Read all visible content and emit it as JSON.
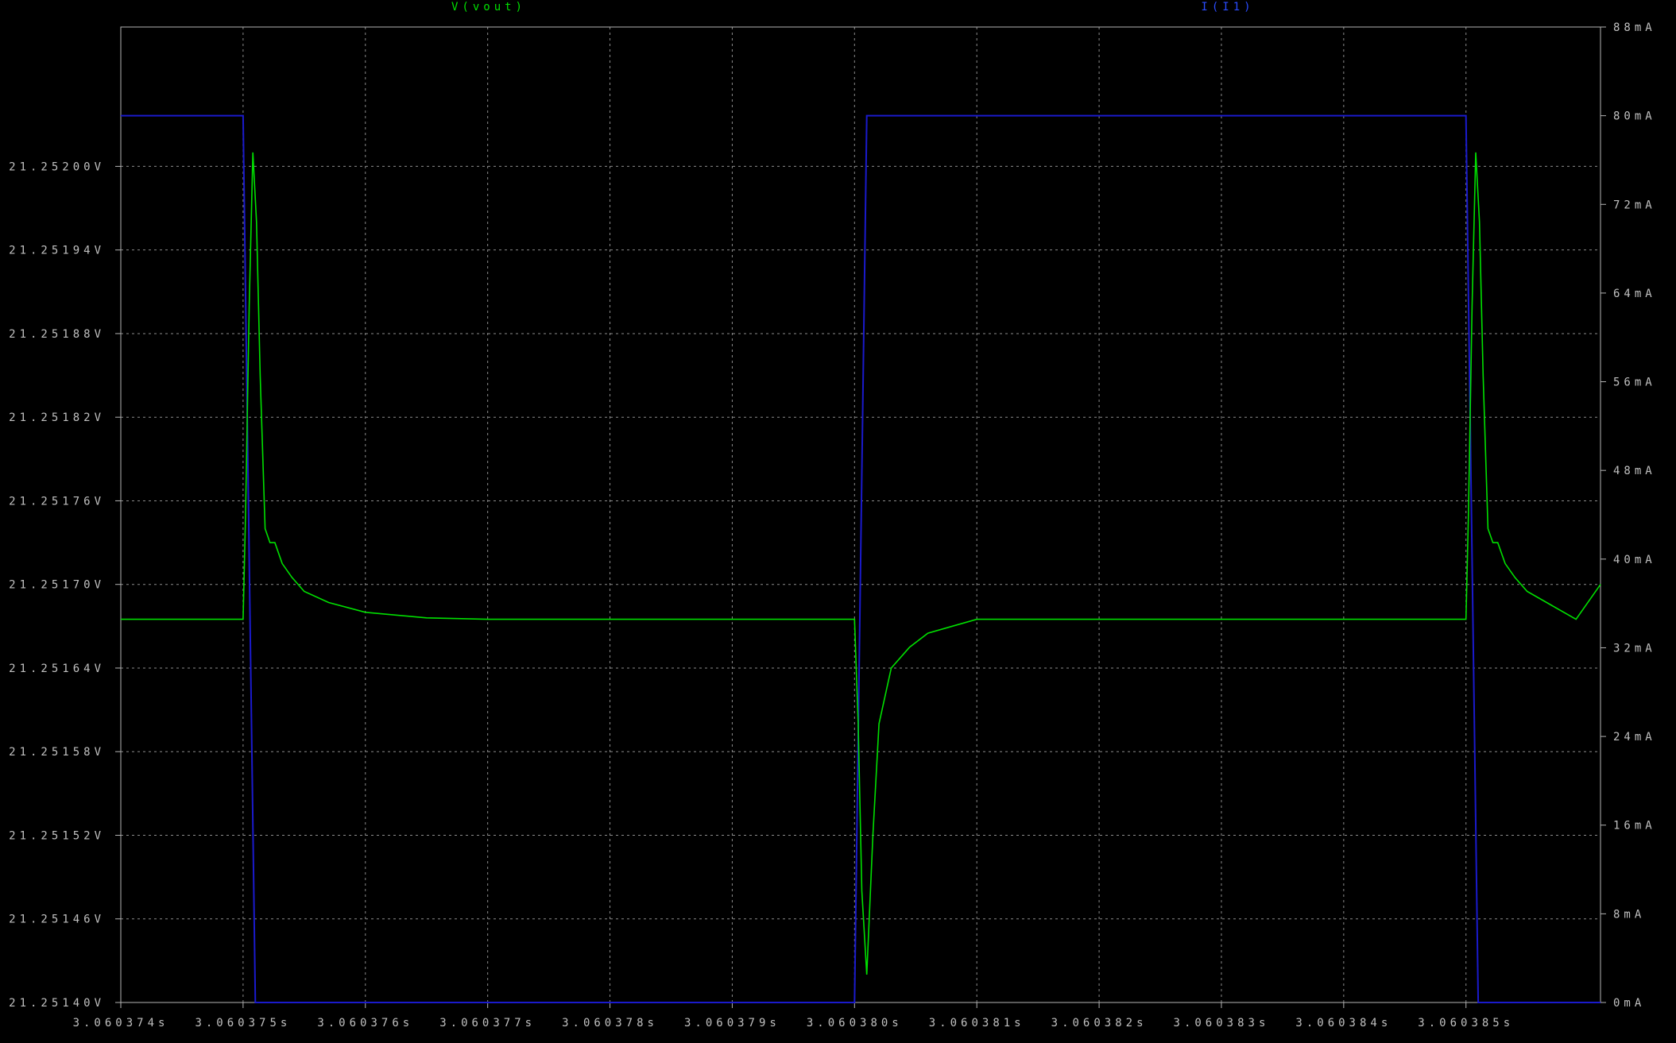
{
  "colors": {
    "background": "#000000",
    "frame": "#b4b4b4",
    "grid": "#8c8c8c",
    "text": "#c0c0c0",
    "vout": "#00e000",
    "current": "#1a1acc",
    "current_label": "#2a4cff"
  },
  "chart_data": {
    "type": "line",
    "grid": true,
    "x": {
      "unit": "s",
      "range": [
        3.060374,
        3.0603861
      ],
      "ticks": [
        3.060374,
        3.060375,
        3.060376,
        3.060377,
        3.060378,
        3.060379,
        3.06038,
        3.060381,
        3.060382,
        3.060383,
        3.060384,
        3.060385
      ],
      "tick_labels": [
        "3.060374s",
        "3.060375s",
        "3.060376s",
        "3.060377s",
        "3.060378s",
        "3.060379s",
        "3.060380s",
        "3.060381s",
        "3.060382s",
        "3.060383s",
        "3.060384s",
        "3.060385s"
      ]
    },
    "y_left": {
      "unit": "V",
      "range": [
        21.2514,
        21.2521
      ],
      "ticks": [
        21.2514,
        21.25146,
        21.25152,
        21.25158,
        21.25164,
        21.2517,
        21.25176,
        21.25182,
        21.25188,
        21.25194,
        21.252
      ],
      "tick_labels": [
        "21.25140V",
        "21.25146V",
        "21.25152V",
        "21.25158V",
        "21.25164V",
        "21.25170V",
        "21.25176V",
        "21.25182V",
        "21.25188V",
        "21.25194V",
        "21.25200V"
      ]
    },
    "y_right": {
      "unit": "mA",
      "range": [
        0,
        88
      ],
      "ticks": [
        0,
        8,
        16,
        24,
        32,
        40,
        48,
        56,
        64,
        72,
        80,
        88
      ],
      "tick_labels": [
        "0mA",
        "8mA",
        "16mA",
        "24mA",
        "32mA",
        "40mA",
        "48mA",
        "56mA",
        "64mA",
        "72mA",
        "80mA",
        "88mA"
      ]
    },
    "series": [
      {
        "name": "V(vout)",
        "axis": "left",
        "x": [
          3.060374,
          3.060375,
          3.06037502,
          3.06037505,
          3.06037508,
          3.06037511,
          3.06037514,
          3.06037518,
          3.06037522,
          3.06037526,
          3.06037532,
          3.0603754,
          3.0603755,
          3.0603757,
          3.060376,
          3.0603765,
          3.060377,
          3.060378,
          3.060379,
          3.06038,
          3.06038003,
          3.06038006,
          3.0603801,
          3.06038015,
          3.0603802,
          3.0603803,
          3.06038045,
          3.0603806,
          3.0603808,
          3.060381,
          3.0603812,
          3.0603815,
          3.060382,
          3.060383,
          3.060384,
          3.060385,
          3.06038502,
          3.06038505,
          3.06038508,
          3.06038511,
          3.06038514,
          3.06038518,
          3.06038522,
          3.06038526,
          3.06038532,
          3.0603854,
          3.0603855,
          3.0603857,
          3.0603859,
          3.0603861
        ],
        "y": [
          21.251675,
          21.251675,
          21.25175,
          21.2519,
          21.25201,
          21.25196,
          21.25185,
          21.25174,
          21.25173,
          21.25173,
          21.251715,
          21.251705,
          21.251695,
          21.251687,
          21.25168,
          21.251676,
          21.251675,
          21.251675,
          21.251675,
          21.251675,
          21.2516,
          21.25148,
          21.25142,
          21.25152,
          21.2516,
          21.25164,
          21.251655,
          21.251665,
          21.25167,
          21.251675,
          21.251675,
          21.251675,
          21.251675,
          21.251675,
          21.251675,
          21.251675,
          21.25175,
          21.2519,
          21.25201,
          21.25196,
          21.25185,
          21.25174,
          21.25173,
          21.25173,
          21.251715,
          21.251705,
          21.251695,
          21.251685,
          21.251675,
          21.2517
        ]
      },
      {
        "name": "I(I1)",
        "axis": "right",
        "x": [
          3.060374,
          3.060375,
          3.0603751,
          3.06038,
          3.0603801,
          3.060385,
          3.0603851,
          3.0603861
        ],
        "y": [
          80,
          80,
          0,
          0,
          80,
          80,
          0,
          0
        ]
      }
    ]
  }
}
